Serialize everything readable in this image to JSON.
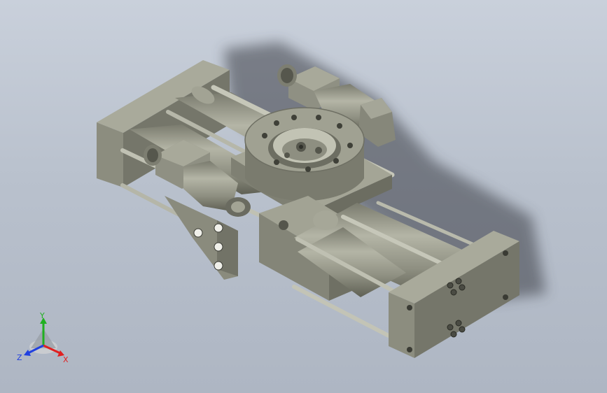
{
  "viewport": {
    "background_top": "#c9d0db",
    "background_bottom": "#aeb6c3",
    "part_color": "#8b8c7e",
    "part_shadow": "#5e5f52",
    "part_highlight": "#b8b9aa"
  },
  "triad": {
    "x_label": "X",
    "y_label": "Y",
    "z_label": "Z",
    "x_color": "#e02020",
    "y_color": "#20b020",
    "z_color": "#2040e0"
  }
}
